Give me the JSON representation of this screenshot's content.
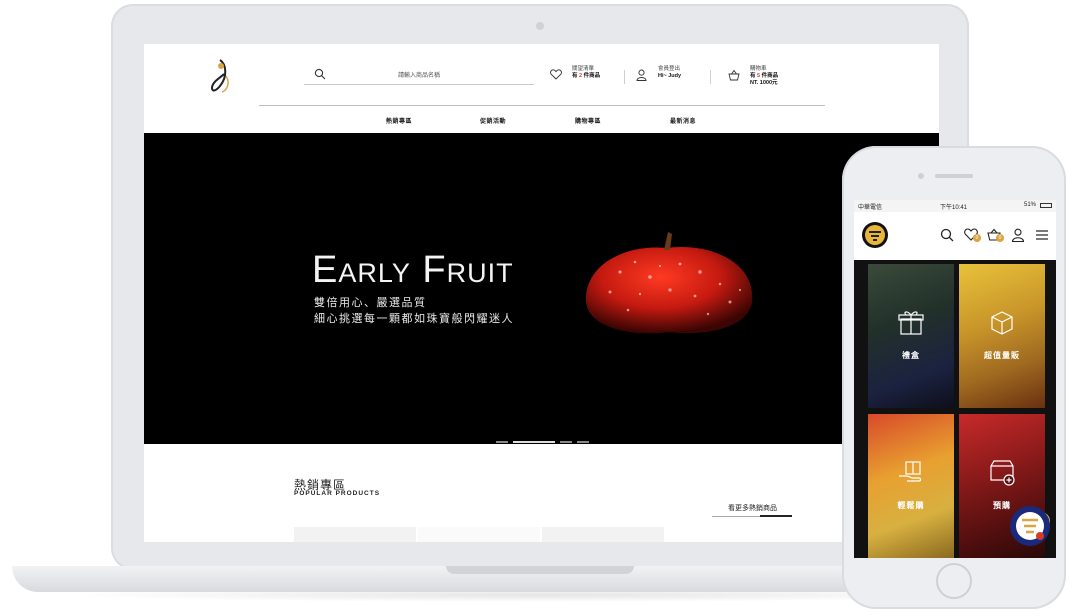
{
  "desktop": {
    "search": {
      "placeholder": "請輸入商品名稱"
    },
    "wishlist": {
      "label": "關望清單",
      "value_prefix": "有",
      "value_count": "2",
      "value_suffix": "件商品"
    },
    "member": {
      "label": "會員登出",
      "value": "Hi~ Judy"
    },
    "cart": {
      "label": "購物車",
      "value_prefix": "有",
      "value_count": "5",
      "value_suffix": "件商品",
      "total": "NT. 1000元"
    },
    "nav": [
      "熱銷專區",
      "促銷活動",
      "購物專區",
      "最新消息"
    ],
    "hero": {
      "title": "Early Fruit",
      "line1": "雙倍用心、嚴選品質",
      "line2": "細心挑選每一顆都如珠寶般閃耀迷人"
    },
    "section": {
      "title": "熱銷專區",
      "subtitle": "POPULAR PRODUCTS",
      "more": "看更多熱銷商品"
    }
  },
  "mobile": {
    "status": {
      "carrier": "中華電信",
      "time": "下午10:41",
      "battery": "51%"
    },
    "header": {
      "wishlist_count": "0",
      "cart_count": "0"
    },
    "tiles": [
      "禮盒",
      "超值量販",
      "輕鬆購",
      "預購"
    ]
  },
  "colors": {
    "accent_red": "#d23c2a",
    "badge_gold": "#d9a441",
    "hero_bg": "#000000"
  }
}
